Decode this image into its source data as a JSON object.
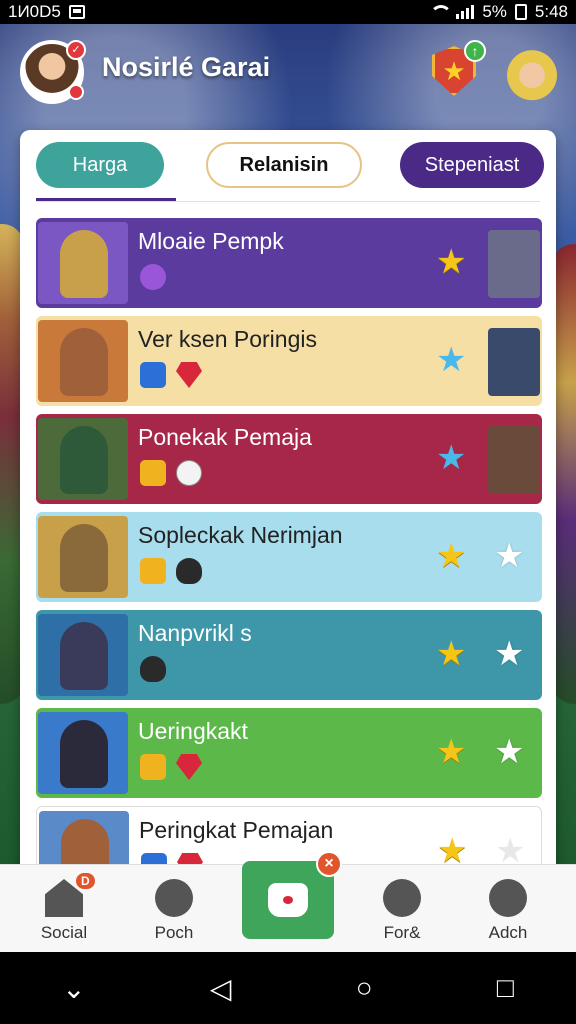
{
  "status_bar": {
    "left_text": "1И0D5",
    "battery_text": "5%",
    "time": "5:48"
  },
  "header": {
    "player_name": "Nosirlé Garai"
  },
  "tabs": [
    {
      "label": "Harga"
    },
    {
      "label": "Relanisin"
    },
    {
      "label": "Stepeniast"
    }
  ],
  "rows": [
    {
      "name": "Mloaie Pempk",
      "bg": "#5b3c9e",
      "dark": true,
      "stars": [
        "gold"
      ]
    },
    {
      "name": "Ver ksen Poringis",
      "bg": "#f6dfa4",
      "dark": false,
      "stars": [
        "blue"
      ]
    },
    {
      "name": "Ponekak Pemaja",
      "bg": "#a62748",
      "dark": true,
      "stars": [
        "blue"
      ]
    },
    {
      "name": "Sopleckak Nerimjan",
      "bg": "#a8ddee",
      "dark": false,
      "stars": [
        "gold",
        "white"
      ]
    },
    {
      "name": "Nanpvrikl s",
      "bg": "#3e97a8",
      "dark": true,
      "stars": [
        "gold",
        "white"
      ]
    },
    {
      "name": "Ueringkakt",
      "bg": "#5bb849",
      "dark": true,
      "stars": [
        "gold",
        "white"
      ]
    },
    {
      "name": "Peringkat Pemajan",
      "bg": "#ffffff",
      "dark": false,
      "stars": [
        "gold",
        "outline"
      ]
    }
  ],
  "bottom_nav": {
    "social": "Social",
    "poch": "Poch",
    "forg": "For&",
    "adch": "Adch",
    "social_badge": "D"
  },
  "icons": {
    "star": "★",
    "back": "◁",
    "home": "○",
    "recents": "□",
    "chevron": "⌄"
  }
}
